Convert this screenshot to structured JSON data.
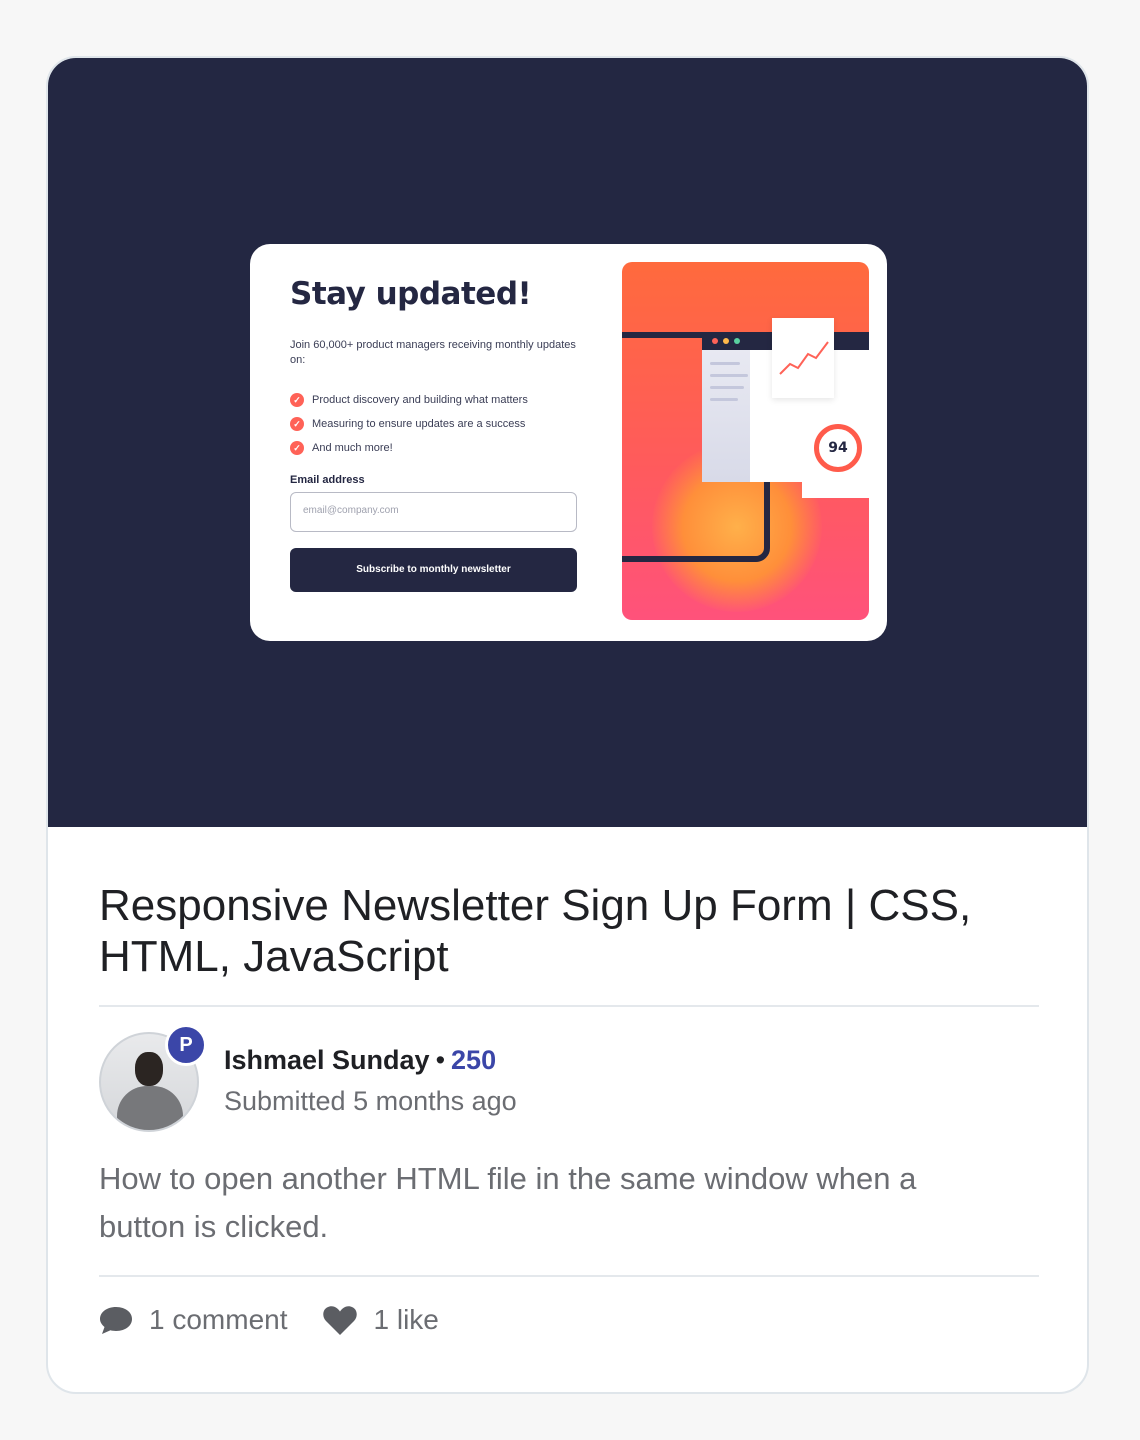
{
  "preview": {
    "heading": "Stay updated!",
    "intro": "Join 60,000+ product managers receiving monthly updates on:",
    "list": [
      "Product discovery and building what matters",
      "Measuring to ensure updates are a success",
      "And much more!"
    ],
    "email_label": "Email address",
    "email_placeholder": "email@company.com",
    "button_label": "Subscribe to monthly newsletter",
    "score": "94"
  },
  "post": {
    "title": "Responsive Newsletter Sign Up Form | CSS, HTML, JavaScript",
    "author": "Ishmael Sunday",
    "separator": "•",
    "author_score": "250",
    "badge": "P",
    "submitted": "Submitted 5 months ago",
    "description": "How to open another HTML file in the same window when a button is clicked.",
    "comments": "1 comment",
    "likes": "1 like"
  },
  "colors": {
    "preview_bg": "#232742",
    "accent": "#3b46a8",
    "tomato": "#ff6257"
  },
  "icons": {
    "comment": "comment-icon",
    "like": "heart-icon"
  }
}
